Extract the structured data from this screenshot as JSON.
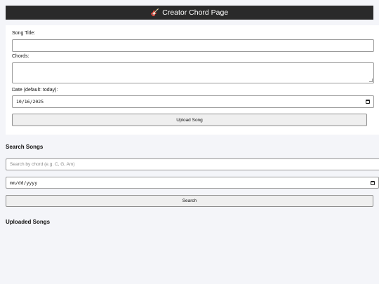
{
  "header": {
    "icon": "guitar-icon",
    "title": "Creator Chord Page"
  },
  "upload_form": {
    "song_title_label": "Song Title:",
    "song_title_value": "",
    "chords_label": "Chords:",
    "chords_value": "",
    "date_label": "Date (default: today):",
    "date_value": "10/16/2025",
    "upload_button": "Upload Song"
  },
  "search": {
    "heading": "Search Songs",
    "chord_placeholder": "Search by chord (e.g. C, G, Am)",
    "date_placeholder": "mm/dd/yyyy",
    "search_button": "Search"
  },
  "uploaded": {
    "heading": "Uploaded Songs"
  }
}
